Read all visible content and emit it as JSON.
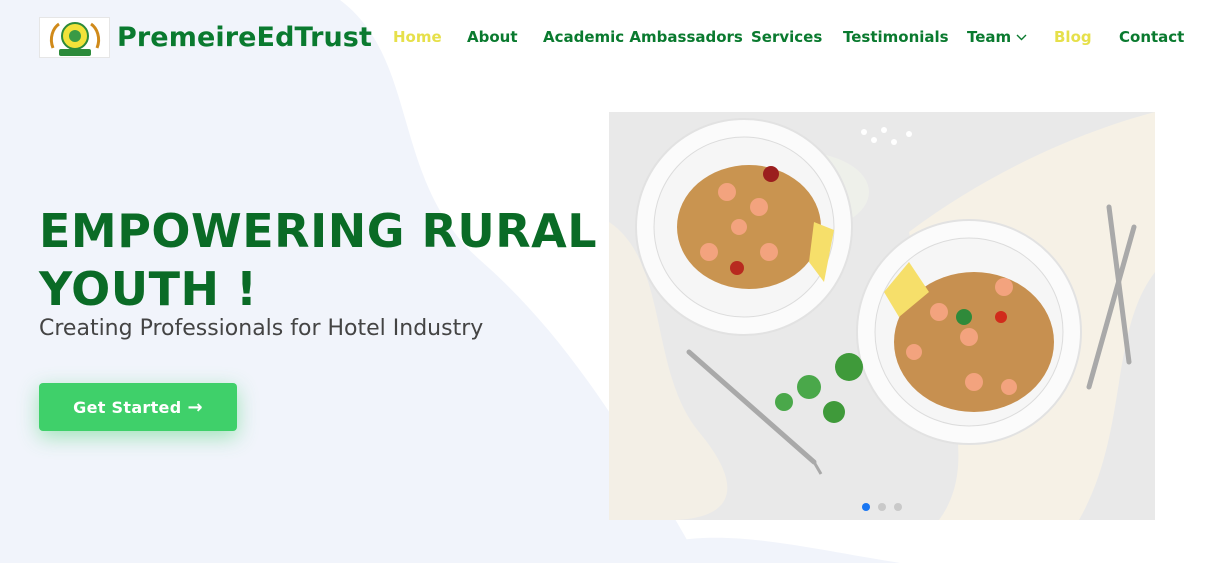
{
  "brand": {
    "name": "PremeireEdTrust",
    "logo_icon": "emblem-logo-icon"
  },
  "nav": {
    "items": [
      {
        "label": "Home",
        "active": true
      },
      {
        "label": "About"
      },
      {
        "label": "Academic Ambassadors"
      },
      {
        "label": "Services"
      },
      {
        "label": "Testimonials"
      },
      {
        "label": "Team",
        "has_dropdown": true
      },
      {
        "label": "Blog",
        "active": true
      },
      {
        "label": "Contact"
      }
    ]
  },
  "hero": {
    "title": "EMPOWERING RURAL YOUTH !",
    "subtitle": "Creating Professionals for Hotel Industry",
    "cta_label": "Get Started",
    "cta_icon": "arrow-right-icon"
  },
  "slider": {
    "image_subject": "two plates of shrimp rice dish with lemon and forks",
    "slide_count": 3,
    "active_slide": 1
  },
  "colors": {
    "brand_green": "#0a7a2f",
    "nav_highlight": "#e6e04a",
    "cta_green": "#3fd06a",
    "dot_active": "#1976f2"
  }
}
